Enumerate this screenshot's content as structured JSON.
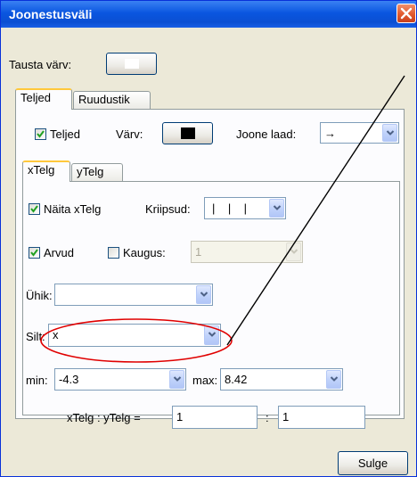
{
  "window": {
    "title": "Joonestusväli"
  },
  "background": {
    "label": "Tausta värv:",
    "color": "#ffffff"
  },
  "tabs": [
    {
      "label": "Teljed",
      "active": true
    },
    {
      "label": "Ruudustik",
      "active": false
    }
  ],
  "axes": {
    "axes_checkbox_label": "Teljed",
    "axes_checked": true,
    "color_label": "Värv:",
    "color": "#000000",
    "line_style_label": "Joone laad:",
    "line_style_value": "→"
  },
  "subtabs": [
    {
      "label": "xTelg",
      "active": true
    },
    {
      "label": "yTelg",
      "active": false
    }
  ],
  "xaxis": {
    "show_label": "Näita xTelg",
    "show_checked": true,
    "ticks_label": "Kriipsud:",
    "ticks_value": "|    |    |",
    "numbers_label": "Arvud",
    "numbers_checked": true,
    "distance_label": "Kaugus:",
    "distance_checked": false,
    "distance_value": "1",
    "unit_label": "Ühik:",
    "unit_value": "",
    "label_label": "Silt:",
    "label_value": "x",
    "min_label": "min:",
    "min_value": "-4.3",
    "max_label": "max:",
    "max_value": "8.42"
  },
  "ratio": {
    "label": "xTelg : yTelg =",
    "x_value": "1",
    "separator": ":",
    "y_value": "1"
  },
  "close_button": {
    "label": "Sulge"
  },
  "annotation": {
    "color": "#e00000"
  }
}
